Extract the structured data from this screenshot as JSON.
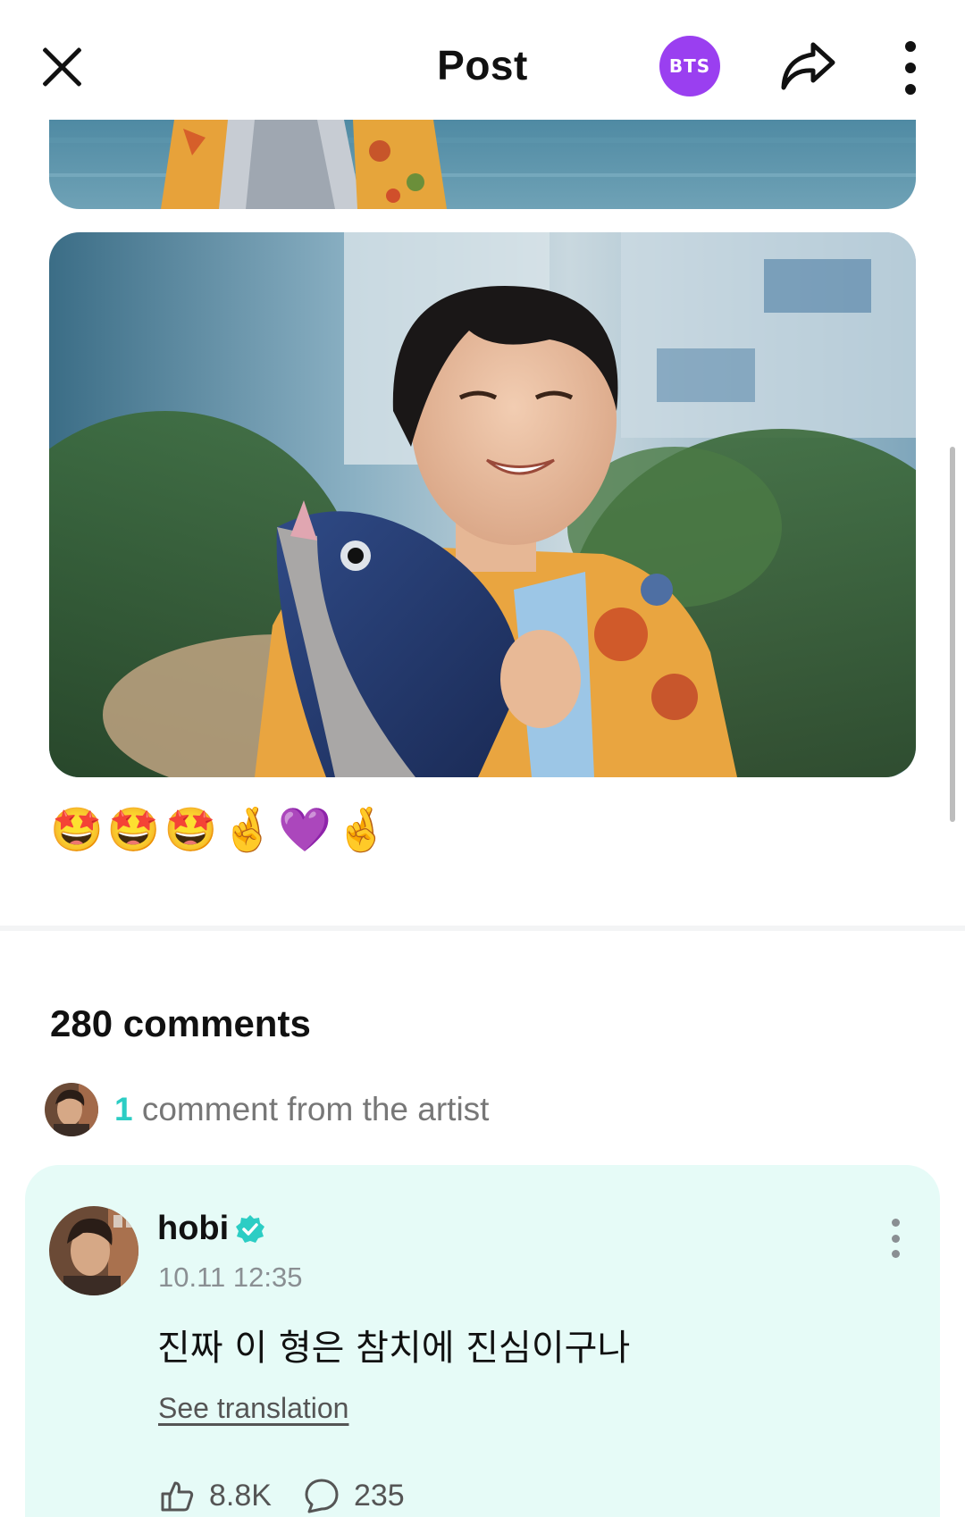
{
  "header": {
    "title": "Post",
    "community_badge": "BTS",
    "badge_color": "#9a3ff0"
  },
  "post": {
    "emojis": "🤩🤩🤩🤞💜🤞"
  },
  "comments": {
    "count_label": "280 comments",
    "artist_count": "1",
    "artist_label": " comment from the artist",
    "accent_color": "#2ccdc4",
    "items": [
      {
        "username": "hobi",
        "verified": true,
        "timestamp": "10.11 12:35",
        "text": "진짜 이 형은 참치에 진심이구나",
        "translate_label": "See translation",
        "likes": "8.8K",
        "replies": "235"
      }
    ]
  },
  "icons": {
    "close": "close-icon",
    "share": "share-icon",
    "more": "more-vertical-icon",
    "verified": "verified-badge-icon",
    "like": "like-icon",
    "reply": "reply-bubble-icon"
  }
}
